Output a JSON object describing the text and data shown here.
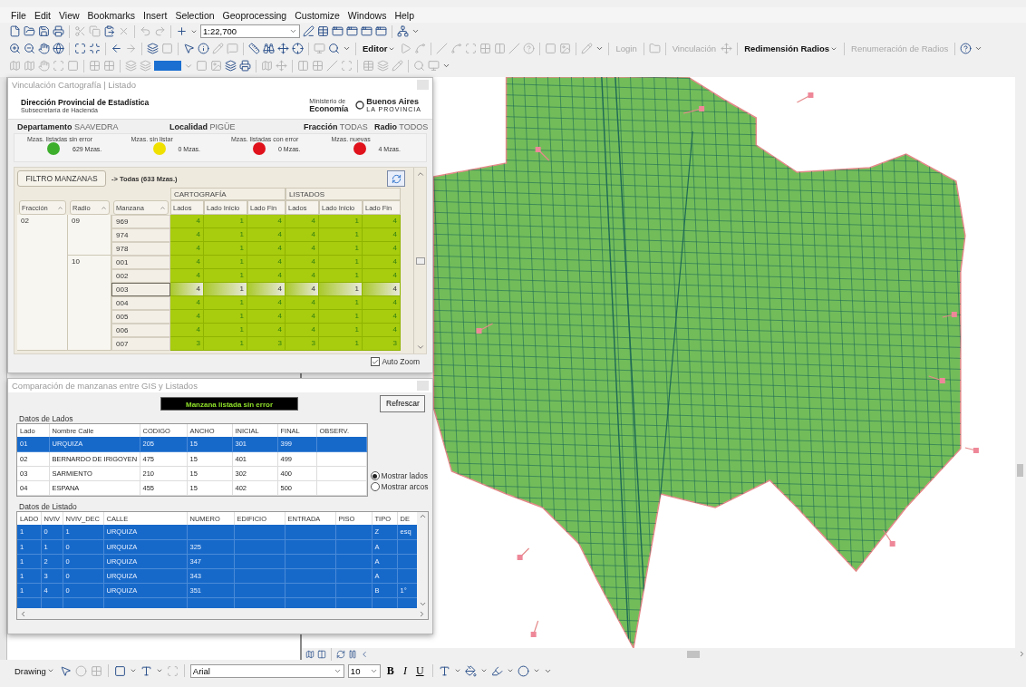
{
  "menu": [
    "File",
    "Edit",
    "View",
    "Bookmarks",
    "Insert",
    "Selection",
    "Geoprocessing",
    "Customize",
    "Windows",
    "Help"
  ],
  "toolbar": {
    "scale": "1:22,700",
    "text_buttons": [
      {
        "label": "Editor",
        "disabled": false,
        "dropdown": true
      },
      {
        "label": "Login",
        "disabled": true,
        "dropdown": false
      },
      {
        "label": "Vinculación",
        "disabled": true,
        "dropdown": false
      },
      {
        "label": "Redimensión Radios",
        "disabled": false,
        "dropdown": true
      },
      {
        "label": "Renumeración de Radios",
        "disabled": true,
        "dropdown": false
      }
    ]
  },
  "vinculacion": {
    "title": "Vinculación Cartografía | Listado",
    "org": "Dirección Provincial de Estadística",
    "org_sub": "Subsecretaría de Hacienda",
    "ministry_small": "Ministerio de",
    "ministry": "Economía",
    "province": "Buenos Aires",
    "province_sub": "LA PROVINCIA",
    "fields": [
      {
        "label": "Departamento",
        "value": "SAAVEDRA"
      },
      {
        "label": "Localidad",
        "value": "PIGÜE"
      },
      {
        "label": "Fracción",
        "value": "TODAS"
      },
      {
        "label": "Radio",
        "value": "TODOS"
      }
    ],
    "indicators": [
      {
        "label": "Mzas. listadas sin error",
        "color": "#3cae2c",
        "count": "629 Mzas."
      },
      {
        "label": "Mzas. sin listar",
        "color": "#f0e000",
        "count": "0 Mzas."
      },
      {
        "label": "Mzas. listadas con error",
        "color": "#e0121c",
        "count": "0 Mzas."
      },
      {
        "label": "Mzas. nuevas",
        "color": "#e0121c",
        "count": "4 Mzas."
      }
    ],
    "filter_button": "FILTRO MANZANAS",
    "filter_text": "-> Todas (633 Mzas.)",
    "grid": {
      "key_columns": [
        "Fracción",
        "Radio",
        "Manzana"
      ],
      "groups": [
        {
          "label": "CARTOGRAFÍA",
          "columns": [
            "Lados",
            "Lado Inicio",
            "Lado Fin"
          ]
        },
        {
          "label": "LISTADOS",
          "columns": [
            "Lados",
            "Lado Inicio",
            "Lado Fin"
          ]
        }
      ],
      "fracciones": [
        {
          "label": "02",
          "radios": [
            {
              "label": "09",
              "manzanas": [
                {
                  "label": "969",
                  "values": [
                    "4",
                    "1",
                    "4",
                    "4",
                    "1",
                    "4"
                  ],
                  "selected": false
                },
                {
                  "label": "974",
                  "values": [
                    "4",
                    "1",
                    "4",
                    "4",
                    "1",
                    "4"
                  ],
                  "selected": false
                },
                {
                  "label": "978",
                  "values": [
                    "4",
                    "1",
                    "4",
                    "4",
                    "1",
                    "4"
                  ],
                  "selected": false
                }
              ]
            },
            {
              "label": "10",
              "manzanas": [
                {
                  "label": "001",
                  "values": [
                    "4",
                    "1",
                    "4",
                    "4",
                    "1",
                    "4"
                  ],
                  "selected": false
                },
                {
                  "label": "002",
                  "values": [
                    "4",
                    "1",
                    "4",
                    "4",
                    "1",
                    "4"
                  ],
                  "selected": false
                },
                {
                  "label": "003",
                  "values": [
                    "4",
                    "1",
                    "4",
                    "4",
                    "1",
                    "4"
                  ],
                  "selected": true
                },
                {
                  "label": "004",
                  "values": [
                    "4",
                    "1",
                    "4",
                    "4",
                    "1",
                    "4"
                  ],
                  "selected": false
                },
                {
                  "label": "005",
                  "values": [
                    "4",
                    "1",
                    "4",
                    "4",
                    "1",
                    "4"
                  ],
                  "selected": false
                },
                {
                  "label": "006",
                  "values": [
                    "4",
                    "1",
                    "4",
                    "4",
                    "1",
                    "4"
                  ],
                  "selected": false
                },
                {
                  "label": "007",
                  "values": [
                    "3",
                    "1",
                    "3",
                    "3",
                    "1",
                    "3"
                  ],
                  "selected": false
                }
              ]
            }
          ]
        }
      ]
    },
    "auto_zoom": {
      "label": "Auto Zoom",
      "checked": true
    }
  },
  "comparacion": {
    "title": "Comparación de manzanas entre GIS y Listados",
    "status": "Manzana listada sin error",
    "refresh": "Refrescar",
    "lados": {
      "title": "Datos de Lados",
      "columns": [
        "Lado",
        "Nombre Calle",
        "CODIGO",
        "ANCHO",
        "INICIAL",
        "FINAL",
        "OBSERV."
      ],
      "rows": [
        {
          "cells": [
            "01",
            "URQUIZA",
            "205",
            "15",
            "301",
            "399",
            null
          ],
          "selected": true
        },
        {
          "cells": [
            "02",
            "BERNARDO DE IRIGOYEN",
            "475",
            "15",
            "401",
            "499",
            null
          ],
          "selected": false
        },
        {
          "cells": [
            "03",
            "SARMIENTO",
            "210",
            "15",
            "302",
            "400",
            null
          ],
          "selected": false
        },
        {
          "cells": [
            "04",
            "ESPANA",
            "455",
            "15",
            "402",
            "500",
            null
          ],
          "selected": false
        }
      ]
    },
    "view_options": [
      {
        "label": "Mostrar lados",
        "selected": true
      },
      {
        "label": "Mostrar arcos",
        "selected": false
      }
    ],
    "listado": {
      "title": "Datos de Listado",
      "columns": [
        "LADO",
        "NVIV",
        "NVIV_DEC",
        "CALLE",
        "NUMERO",
        "EDIFICIO",
        "ENTRADA",
        "PISO",
        "TIPO",
        "DE"
      ],
      "rows": [
        {
          "cells": [
            "1",
            "0",
            "1",
            "URQUIZA",
            null,
            null,
            null,
            null,
            "Z",
            "esq"
          ],
          "selected": true
        },
        {
          "cells": [
            "1",
            "1",
            "0",
            "URQUIZA",
            "325",
            null,
            null,
            null,
            "A",
            null
          ],
          "selected": true
        },
        {
          "cells": [
            "1",
            "2",
            "0",
            "URQUIZA",
            "347",
            null,
            null,
            null,
            "A",
            null
          ],
          "selected": true
        },
        {
          "cells": [
            "1",
            "3",
            "0",
            "URQUIZA",
            "343",
            null,
            null,
            null,
            "A",
            null
          ],
          "selected": true
        },
        {
          "cells": [
            "1",
            "4",
            "0",
            "URQUIZA",
            "351",
            null,
            null,
            null,
            "B",
            "1°"
          ],
          "selected": true
        }
      ]
    }
  },
  "drawing_toolbar": {
    "menu": "Drawing",
    "font": "Arial",
    "size": "10",
    "styles": [
      {
        "label": "B",
        "kind": "bold"
      },
      {
        "label": "I",
        "kind": "italic"
      },
      {
        "label": "U",
        "kind": "underline"
      }
    ]
  }
}
